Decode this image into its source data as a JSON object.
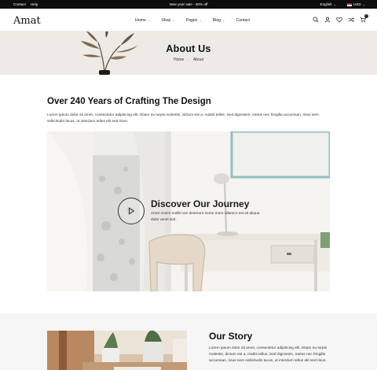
{
  "topbar": {
    "links": [
      "Contact",
      "Help"
    ],
    "promo": "New year sale - 30% off",
    "language": "English",
    "currency": "USD"
  },
  "header": {
    "logo": "Amat",
    "nav": [
      {
        "label": "Home",
        "has_dropdown": true
      },
      {
        "label": "Shop",
        "has_dropdown": true
      },
      {
        "label": "Pages",
        "has_dropdown": true
      },
      {
        "label": "Blog",
        "has_dropdown": true
      },
      {
        "label": "Contact",
        "has_dropdown": false
      }
    ],
    "icons": [
      "search-icon",
      "user-icon",
      "heart-icon",
      "shuffle-icon",
      "cart-icon"
    ],
    "cart_count": "0"
  },
  "banner": {
    "title": "About Us",
    "breadcrumb": [
      "Home",
      "About"
    ]
  },
  "intro": {
    "title": "Over 240 Years of Crafting The Design",
    "text": "Lorem ipsum dolor sit amet, consectetur adipiscing elit. Etiam eu turpis molestie, dictum est a, mattis tellus. Sed dignissim, metus nec fringilla accumsan, risus sem sollicitudin lacus, ut interdum tellus elit sed risus."
  },
  "video": {
    "title": "Discover Our Journey",
    "text": "Amet minim mollit non deserunt some more ullamco est sit aliqua dolor amet sint."
  },
  "story": {
    "title": "Our Story",
    "text": "Lorem ipsum dolor sit amet, consectetur adipiscing elit. Etiam eu turpis molestie, dictum est a, mattis tellus. Sed dignissim, metus nec fringilla accumsan, risus sem sollicitudin lacus, ut interdum tellus elit sed risus."
  },
  "colors": {
    "topbar_bg": "#0d0d0d",
    "banner_bg": "#eeeae5",
    "story_bg": "#f6f6f6",
    "text": "#111111"
  }
}
